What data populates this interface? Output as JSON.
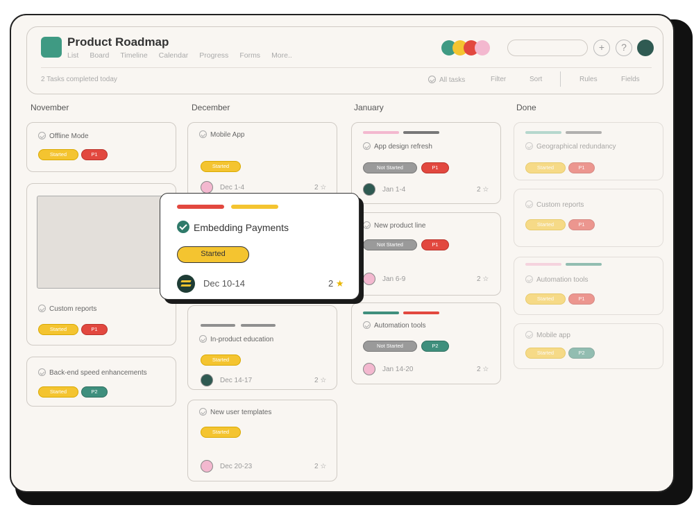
{
  "header": {
    "title": "Product Roadmap",
    "nav": [
      "List",
      "Board",
      "Timeline",
      "Calendar",
      "Progress",
      "Forms",
      "More.."
    ],
    "completed": "2 Tasks completed today",
    "tools": {
      "all_tasks": "All tasks",
      "filter": "Filter",
      "sort": "Sort",
      "rules": "Rules",
      "fields": "Fields"
    },
    "plus": "+",
    "help": "?"
  },
  "colors": {
    "teal": "#3f9a83",
    "yellow": "#f4c430",
    "red": "#e2483f",
    "pink": "#f3b8cf",
    "dark": "#2f5a52"
  },
  "columns": {
    "november": {
      "header": "November",
      "cards": [
        {
          "title": "Offline Mode",
          "tags": [
            "Started",
            "P1"
          ]
        },
        {
          "title": "Custom reports",
          "tags": [
            "Started",
            "P1"
          ]
        },
        {
          "title": "Back-end speed enhancements",
          "tags": [
            "Started",
            "P2"
          ]
        }
      ]
    },
    "december": {
      "header": "December",
      "cards": [
        {
          "title": "Mobile App",
          "tags": [
            "Started"
          ],
          "date": "Dec 1-4",
          "count": "2 ☆"
        },
        {
          "title": "In-product education",
          "tags": [
            "Started"
          ],
          "date": "Dec 14-17",
          "count": "2 ☆"
        },
        {
          "title": "New user templates",
          "tags": [
            "Started"
          ],
          "date": "Dec 20-23",
          "count": "2 ☆"
        }
      ]
    },
    "january": {
      "header": "January",
      "cards": [
        {
          "title": "App design refresh",
          "tags": [
            "Not Started",
            "P1"
          ],
          "date": "Jan 1-4",
          "count": "2 ☆"
        },
        {
          "title": "New product line",
          "tags": [
            "Not Started",
            "P1"
          ],
          "date": "Jan 6-9",
          "count": "2 ☆"
        },
        {
          "title": "Automation tools",
          "tags": [
            "Not Started",
            "P2"
          ],
          "date": "Jan 14-20",
          "count": "2 ☆"
        }
      ]
    },
    "done": {
      "header": "Done",
      "cards": [
        {
          "title": "Geographical redundancy",
          "tags": [
            "Started",
            "P1"
          ]
        },
        {
          "title": "Custom reports",
          "tags": [
            "Started",
            "P1"
          ]
        },
        {
          "title": "Automation tools",
          "tags": [
            "Started",
            "P1"
          ]
        },
        {
          "title": "Mobile app",
          "tags": [
            "Started",
            "P2"
          ]
        }
      ]
    }
  },
  "popup": {
    "title": "Embedding Payments",
    "status": "Started",
    "date": "Dec 10-14",
    "count": "2",
    "star": "★"
  }
}
